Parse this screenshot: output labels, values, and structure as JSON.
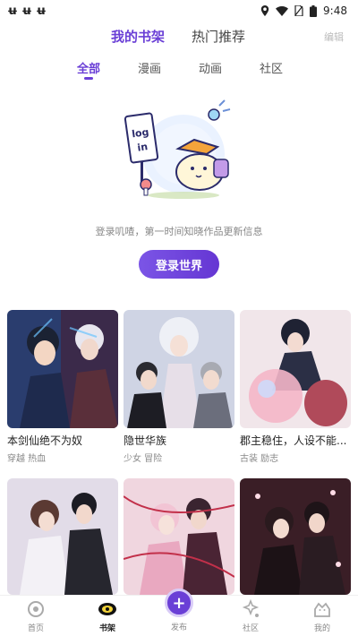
{
  "status_bar": {
    "left_icons": [
      "app-notification-icon",
      "app-notification-icon",
      "app-notification-icon"
    ],
    "left_glyphs": [
      "ʉ",
      "ʉ",
      "ʉ"
    ],
    "time": "9:48"
  },
  "top_tabs": [
    {
      "label": "我的书架",
      "active": true
    },
    {
      "label": "热门推荐",
      "active": false
    }
  ],
  "edit_label": "编辑",
  "sub_tabs": [
    {
      "label": "全部",
      "active": true
    },
    {
      "label": "漫画",
      "active": false
    },
    {
      "label": "动画",
      "active": false
    },
    {
      "label": "社区",
      "active": false
    }
  ],
  "illustration": {
    "sign_text": "log in"
  },
  "login_hint": "登录叽喳，第一时间知晓作品更新信息",
  "login_button": "登录世界",
  "comics": [
    {
      "title": "本剑仙绝不为奴",
      "tags": "穿越 热血"
    },
    {
      "title": "隐世华族",
      "tags": "少女 冒险"
    },
    {
      "title": "郡主稳住，人设不能...",
      "tags": "古装 励志"
    },
    {
      "title": "",
      "tags": ""
    },
    {
      "title": "",
      "tags": ""
    },
    {
      "title": "",
      "tags": ""
    }
  ],
  "bottom_nav": [
    {
      "label": "首页",
      "icon": "home-icon",
      "active": false
    },
    {
      "label": "书架",
      "icon": "bookshelf-icon",
      "active": true
    },
    {
      "label": "发布",
      "icon": "publish-plus-icon",
      "active": false
    },
    {
      "label": "社区",
      "icon": "community-icon",
      "active": false
    },
    {
      "label": "我的",
      "icon": "profile-icon",
      "active": false
    }
  ],
  "colors": {
    "accent": "#6a3fd6",
    "accent_light": "#d9ccf7"
  }
}
